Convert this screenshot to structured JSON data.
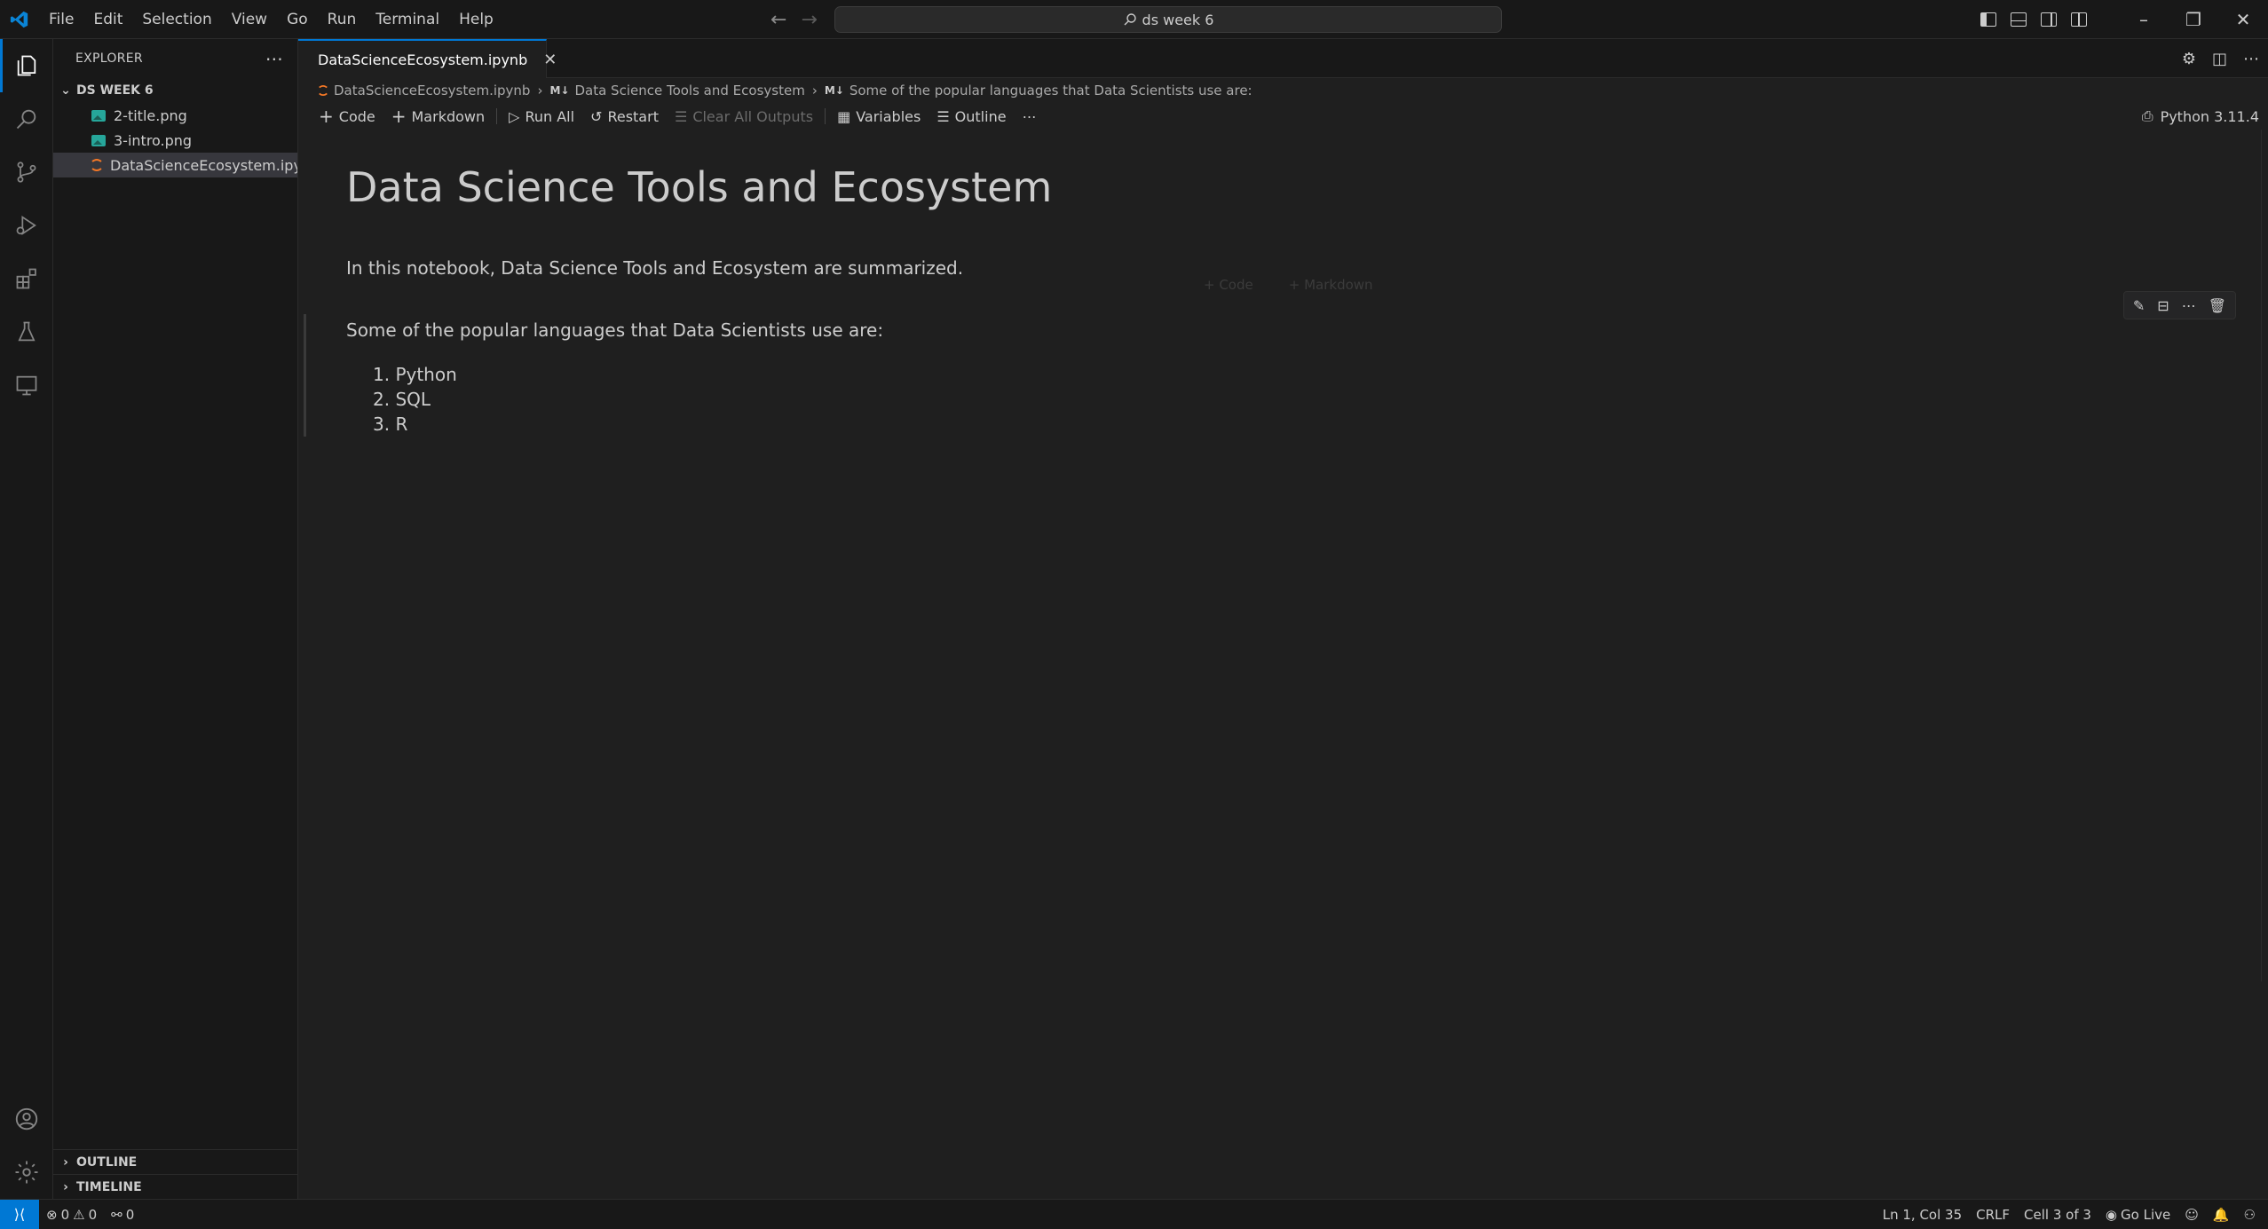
{
  "titlebar": {
    "menu": [
      "File",
      "Edit",
      "Selection",
      "View",
      "Go",
      "Run",
      "Terminal",
      "Help"
    ],
    "search": "ds week 6"
  },
  "sidebar": {
    "title": "EXPLORER",
    "folder": "DS WEEK 6",
    "files": [
      {
        "name": "2-title.png",
        "icon": "image-icon"
      },
      {
        "name": "3-intro.png",
        "icon": "image-icon"
      },
      {
        "name": "DataScienceEcosystem.ipy...",
        "icon": "notebook-icon",
        "selected": true
      }
    ],
    "outline": "OUTLINE",
    "timeline": "TIMELINE"
  },
  "editor": {
    "tab": "DataScienceEcosystem.ipynb",
    "breadcrumb": {
      "file": "DataScienceEcosystem.ipynb",
      "md_badge": "M↓",
      "section1": "Data Science Tools and Ecosystem",
      "section2": "Some of the popular languages that Data Scientists use are:"
    },
    "toolbar": {
      "code": "Code",
      "markdown": "Markdown",
      "run_all": "Run All",
      "restart": "Restart",
      "clear": "Clear All Outputs",
      "variables": "Variables",
      "outline": "Outline",
      "kernel": "Python 3.11.4"
    },
    "notebook": {
      "heading": "Data Science Tools and Ecosystem",
      "intro": "In this notebook, Data Science Tools and Ecosystem are summarized.",
      "ghost_code": "+ Code",
      "ghost_markdown": "+ Markdown",
      "languages_intro": "Some of the popular languages that Data Scientists use are:",
      "languages": [
        "1. Python",
        "2. SQL",
        "3. R"
      ]
    }
  },
  "statusbar": {
    "errors": "0",
    "warnings": "0",
    "ports": "0",
    "position": "Ln 1, Col 35",
    "eol": "CRLF",
    "cell": "Cell 3 of 3",
    "golive": "Go Live"
  },
  "colors": {
    "accent": "#0078d4",
    "background": "#1f1f1f",
    "chrome": "#181818"
  }
}
